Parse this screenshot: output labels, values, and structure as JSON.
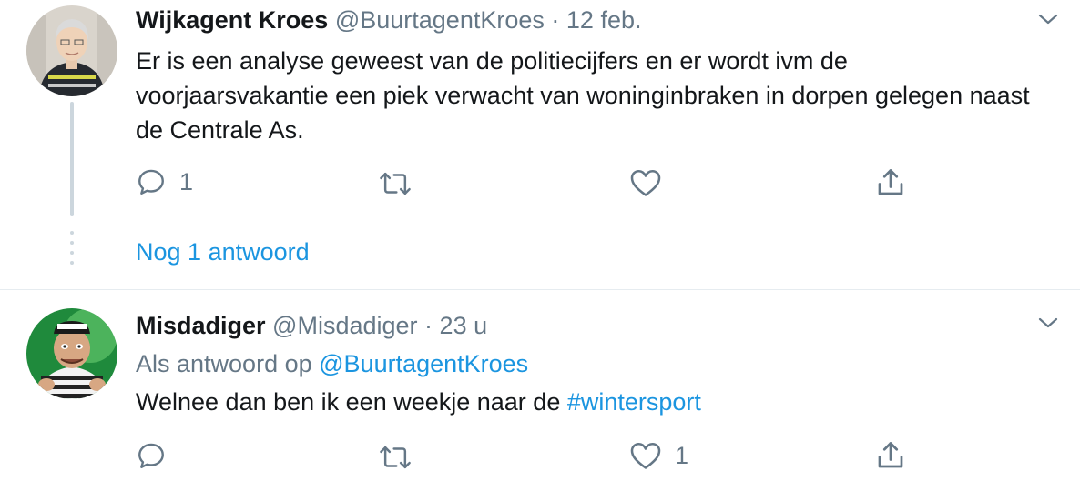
{
  "tweets": [
    {
      "author_name": "Wijkagent Kroes",
      "handle": "@BuurtagentKroes",
      "separator": "·",
      "time": "12 feb.",
      "text": "Er is een analyse geweest van de politiecijfers en er wordt ivm de voorjaarsvakantie een piek verwacht van woninginbraken in dorpen gelegen naast de Centrale As.",
      "reply_count": "1",
      "retweet_count": "",
      "like_count": "",
      "show_more_replies": "Nog 1 antwoord"
    },
    {
      "author_name": "Misdadiger",
      "handle": "@Misdadiger",
      "separator": "·",
      "time": "23 u",
      "replying_prefix": "Als antwoord op",
      "replying_to": "@BuurtagentKroes",
      "text_main": "Welnee dan ben ik een weekje naar de",
      "hashtag": "#wintersport",
      "reply_count": "",
      "retweet_count": "",
      "like_count": "1"
    }
  ],
  "icons": [
    "reply-icon",
    "retweet-icon",
    "like-icon",
    "share-icon",
    "chevron-down-icon"
  ],
  "colors": {
    "link": "#1b95e0",
    "secondary_text": "#657786",
    "primary_text": "#14171a",
    "thread_line": "#ccd6dd",
    "divider": "#e6ecf0"
  }
}
